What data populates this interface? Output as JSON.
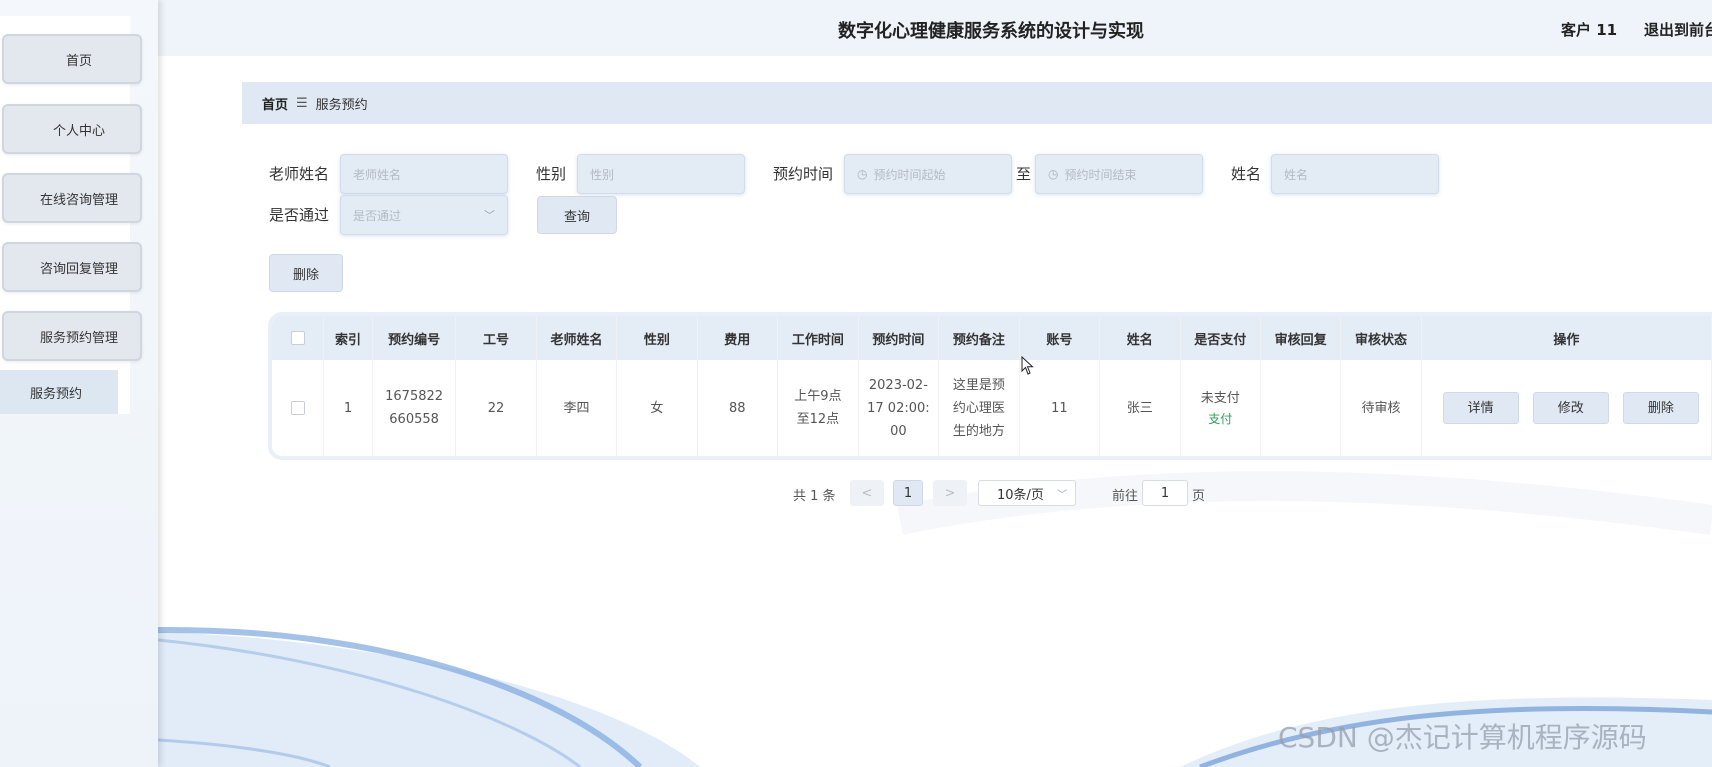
{
  "app": {
    "title": "数字化心理健康服务系统的设计与实现",
    "user": "客户 11",
    "logout": "退出到前台"
  },
  "sidebar": {
    "items": [
      {
        "label": "首页"
      },
      {
        "label": "个人中心"
      },
      {
        "label": "在线咨询管理"
      },
      {
        "label": "咨询回复管理"
      },
      {
        "label": "服务预约管理"
      }
    ],
    "active_sub": "服务预约"
  },
  "breadcrumb": {
    "home": "首页",
    "separator": "☰",
    "current": "服务预约"
  },
  "filters": {
    "teacher_label": "老师姓名",
    "teacher_placeholder": "老师姓名",
    "gender_label": "性别",
    "gender_placeholder": "性别",
    "time_label": "预约时间",
    "time_start_placeholder": "预约时间起始",
    "time_to": "至",
    "time_end_placeholder": "预约时间结束",
    "name_label": "姓名",
    "name_placeholder": "姓名",
    "approved_label": "是否通过",
    "approved_placeholder": "是否通过",
    "query_button": "查询"
  },
  "actions": {
    "delete_button": "删除"
  },
  "table": {
    "headers": [
      "索引",
      "预约编号",
      "工号",
      "老师姓名",
      "性别",
      "费用",
      "工作时间",
      "预约时间",
      "预约备注",
      "账号",
      "姓名",
      "是否支付",
      "审核回复",
      "审核状态",
      "操作"
    ],
    "rows": [
      {
        "index": "1",
        "booking_no": "1675822660558",
        "staff_no": "22",
        "teacher": "李四",
        "gender": "女",
        "fee": "88",
        "work_time": "上午9点至12点",
        "booking_time": "2023-02-17 02:00:00",
        "note": "这里是预约心理医生的地方",
        "account": "11",
        "name": "张三",
        "paid": "未支付",
        "pay_link": "支付",
        "review_reply": "",
        "review_status": "待审核",
        "ops": {
          "detail": "详情",
          "edit": "修改",
          "delete": "删除"
        }
      }
    ]
  },
  "pagination": {
    "total": "共 1 条",
    "prev": "<",
    "current": "1",
    "next": ">",
    "page_size": "10条/页",
    "goto_label": "前往",
    "goto_value": "1",
    "page_suffix": "页"
  },
  "watermark": "CSDN @杰记计算机程序源码"
}
